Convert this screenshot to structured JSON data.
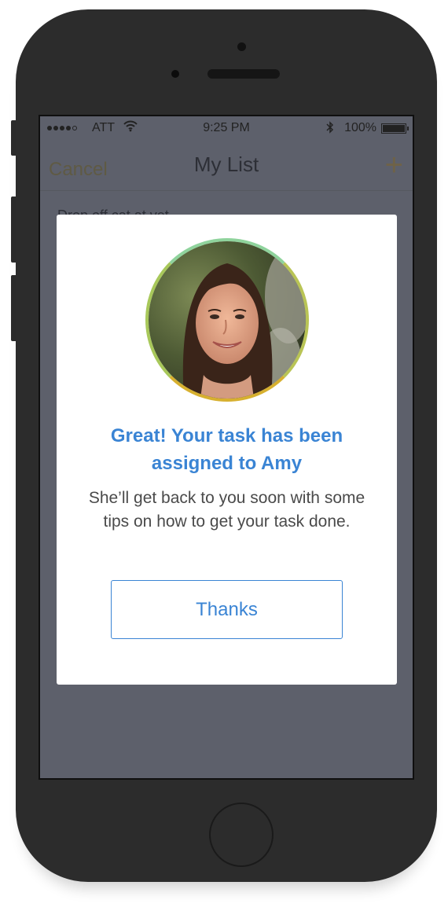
{
  "status_bar": {
    "carrier": "ATT",
    "time": "9:25 PM",
    "battery": "100%",
    "signal_bars_filled": 4,
    "signal_bars_total": 5,
    "icons": [
      "signal-dots-icon",
      "wifi-icon",
      "bluetooth-icon",
      "battery-icon"
    ]
  },
  "navbar": {
    "left_label": "Cancel",
    "title": "My List",
    "right_label": "+"
  },
  "list_peek": {
    "text": "Drop off cat at vet"
  },
  "modal": {
    "avatar_name": "Amy",
    "title": "Great! Your task has been assigned to Amy",
    "body": "She’ll get back to you soon with some tips on how to get your task done.",
    "button_label": "Thanks"
  },
  "colors": {
    "accent_blue": "#3a84d4",
    "overlay": "#5d606b",
    "avatar_ring_gold": "#d7b02f",
    "avatar_ring_green": "#8fd39c"
  }
}
